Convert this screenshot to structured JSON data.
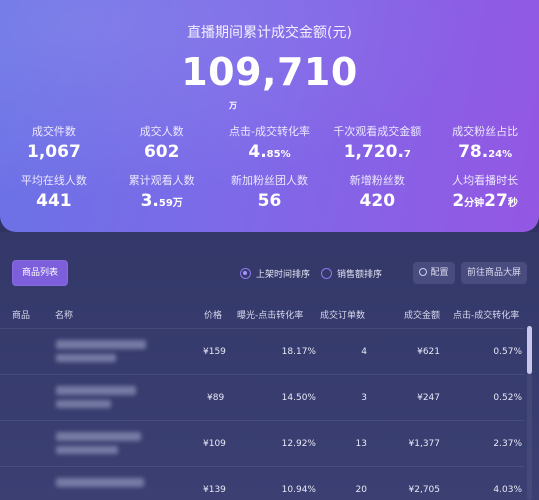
{
  "summary": {
    "title": "直播期间累计成交金额(元)",
    "value": "109,710",
    "unit": "万"
  },
  "metrics": [
    {
      "label": "成交件数",
      "value": "1,067",
      "suffix": ""
    },
    {
      "label": "成交人数",
      "value": "602",
      "suffix": ""
    },
    {
      "label": "点击-成交转化率",
      "value": "4.",
      "suffix": "85%"
    },
    {
      "label": "千次观看成交金额",
      "value": "1,720.",
      "suffix": "7"
    },
    {
      "label": "成交粉丝占比",
      "value": "78.",
      "suffix": "24%"
    },
    {
      "label": "平均在线人数",
      "value": "441",
      "suffix": ""
    },
    {
      "label": "累计观看人数",
      "value": "3.",
      "suffix": "59万"
    },
    {
      "label": "新加粉丝团人数",
      "value": "56",
      "suffix": ""
    },
    {
      "label": "新增粉丝数",
      "value": "420",
      "suffix": ""
    },
    {
      "label": "人均看播时长",
      "value": "2",
      "suffix": "分钟",
      "value2": "27",
      "suffix2": "秒"
    }
  ],
  "toolbar": {
    "product_list_tab": "商品列表",
    "sort_by_listing_time": "上架时间排序",
    "sort_by_sales": "销售额排序",
    "config_button": "配置",
    "big_screen_button": "前往商品大屏"
  },
  "table": {
    "columns": [
      "商品",
      "名称",
      "价格",
      "曝光-点击转化率",
      "成交订单数",
      "成交金额",
      "点击-成交转化率"
    ],
    "rows": [
      {
        "price": "¥159",
        "exposure_click_rate": "18.17%",
        "orders": "4",
        "amount": "¥621",
        "click_deal_rate": "0.57%"
      },
      {
        "price": "¥89",
        "exposure_click_rate": "14.50%",
        "orders": "3",
        "amount": "¥247",
        "click_deal_rate": "0.52%"
      },
      {
        "price": "¥109",
        "exposure_click_rate": "12.92%",
        "orders": "13",
        "amount": "¥1,377",
        "click_deal_rate": "2.37%"
      },
      {
        "price": "¥139",
        "exposure_click_rate": "10.94%",
        "orders": "20",
        "amount": "¥2,705",
        "click_deal_rate": "4.03%"
      }
    ]
  },
  "colors": {
    "card_gradient_start": "#6a72e6",
    "card_gradient_end": "#9457e3",
    "panel_bg": "#333869",
    "accent": "#7d5fdc"
  }
}
